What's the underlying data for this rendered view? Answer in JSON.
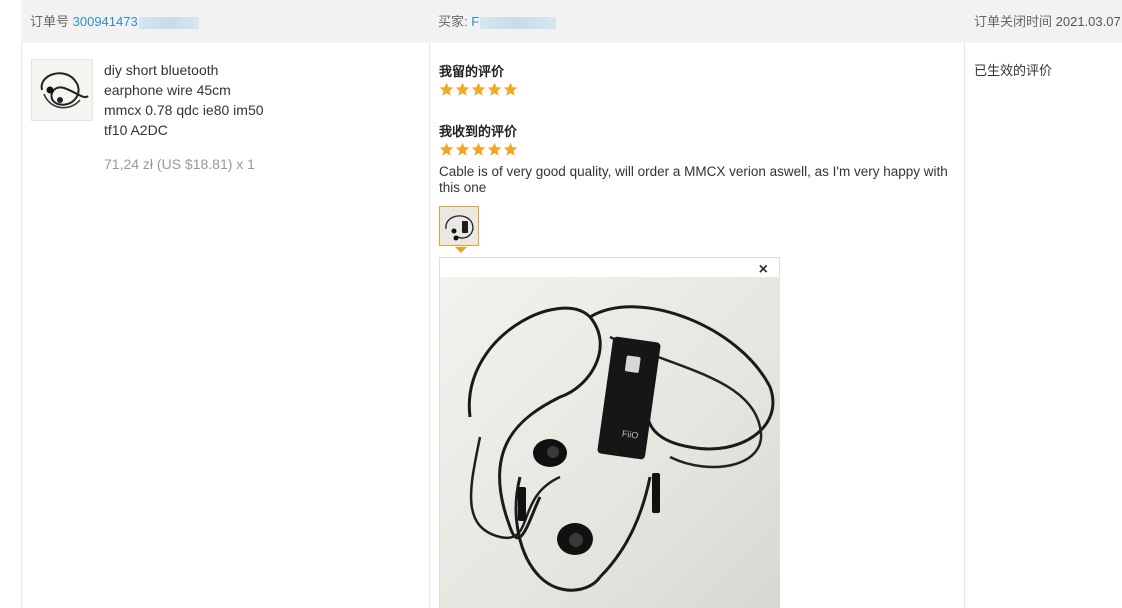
{
  "order": {
    "number_label": "订单号",
    "number_value": "300941473",
    "buyer_label": "买家:",
    "buyer_value": "F",
    "closed_label": "订单关闭时间",
    "closed_date": "2021.03.07"
  },
  "product": {
    "title_lines": [
      "diy short bluetooth",
      "earphone wire 45cm",
      "mmcx 0.78 qdc ie80 im50",
      "tf10 A2DC"
    ],
    "price": "71,24 zł (US $18.81) x 1"
  },
  "my_review": {
    "heading": "我留的评价",
    "stars": 5
  },
  "received_review": {
    "heading": "我收到的评价",
    "stars": 5,
    "text": "Cable is of very good quality, will order a MMCX verion aswell, as I'm very happy with this one"
  },
  "preview": {
    "close_glyph": "×"
  },
  "status": {
    "text": "已生效的评价"
  },
  "colors": {
    "star": "#f5a623",
    "link": "#2f8cd2",
    "header_bg": "#f2f2f2",
    "thumb_border": "#e8a030"
  },
  "icons": {
    "star": "star-icon",
    "close": "close-icon"
  }
}
